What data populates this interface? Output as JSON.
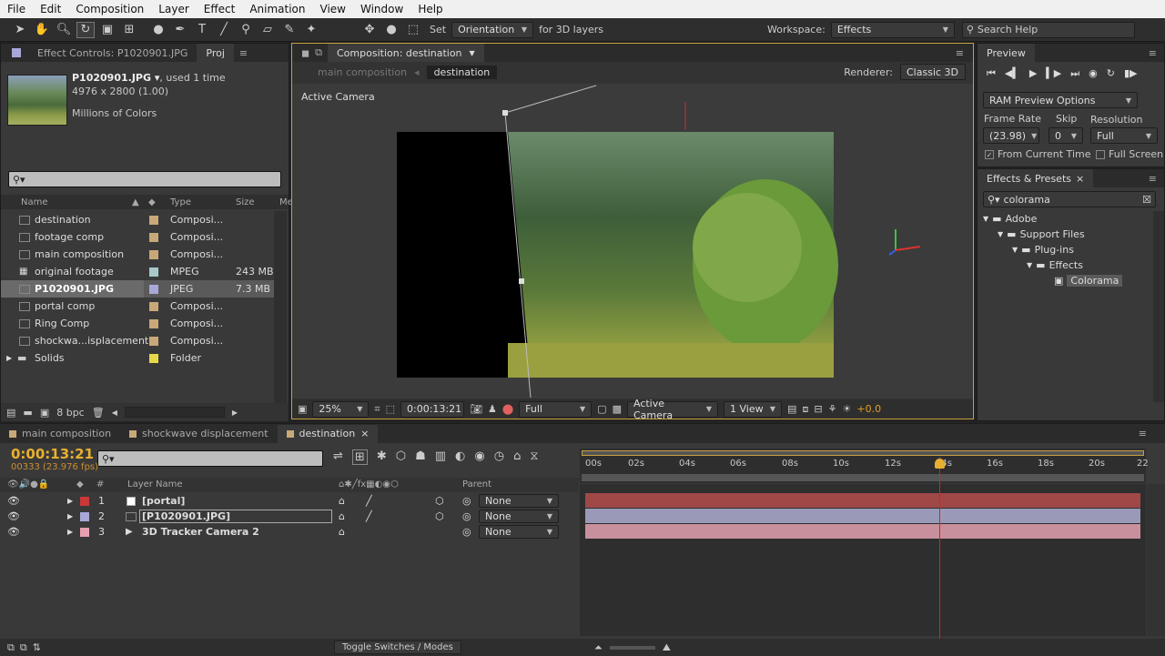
{
  "menu": [
    "File",
    "Edit",
    "Composition",
    "Layer",
    "Effect",
    "Animation",
    "View",
    "Window",
    "Help"
  ],
  "toolbar": {
    "set_label": "Set",
    "orientation": "Orientation",
    "for3d": "for 3D layers",
    "workspace_label": "Workspace:",
    "workspace_value": "Effects",
    "search_help": "Search Help"
  },
  "project": {
    "tab_effect": "Effect Controls: P1020901.JPG",
    "tab_proj": "Proj",
    "file_name": "P1020901.JPG ▾",
    "used": ", used 1 time",
    "dims": "4976 x 2800 (1.00)",
    "colors": "Millions of Colors",
    "col_name": "Name",
    "col_type": "Type",
    "col_size": "Size",
    "col_more": "Me",
    "items": [
      {
        "name": "destination",
        "type": "Composi...",
        "size": "",
        "color": "#c8a878",
        "icon": "comp"
      },
      {
        "name": "footage comp",
        "type": "Composi...",
        "size": "",
        "color": "#c8a878",
        "icon": "comp"
      },
      {
        "name": "main composition",
        "type": "Composi...",
        "size": "",
        "color": "#c8a878",
        "icon": "comp"
      },
      {
        "name": "original footage",
        "type": "MPEG",
        "size": "243 MB",
        "color": "#a8c8c8",
        "icon": "film"
      },
      {
        "name": "P1020901.JPG",
        "type": "JPEG",
        "size": "7.3 MB",
        "color": "#a8a8d8",
        "icon": "img"
      },
      {
        "name": "portal comp",
        "type": "Composi...",
        "size": "",
        "color": "#c8a878",
        "icon": "comp"
      },
      {
        "name": "Ring Comp",
        "type": "Composi...",
        "size": "",
        "color": "#c8a878",
        "icon": "comp"
      },
      {
        "name": "shockwa...isplacement",
        "type": "Composi...",
        "size": "",
        "color": "#c8a878",
        "icon": "comp"
      },
      {
        "name": "Solids",
        "type": "Folder",
        "size": "",
        "color": "#e8d848",
        "icon": "folder"
      }
    ],
    "bpc": "8 bpc"
  },
  "comp": {
    "tab": "Composition: destination",
    "crumb_main": "main composition",
    "crumb_dest": "destination",
    "renderer_label": "Renderer:",
    "renderer": "Classic 3D",
    "active_camera": "Active Camera",
    "zoom": "25%",
    "timecode": "0:00:13:21",
    "res": "Full",
    "view_cam": "Active Camera",
    "views": "1 View",
    "offset": "+0.0"
  },
  "preview": {
    "title": "Preview",
    "ram": "RAM Preview Options",
    "fr_label": "Frame Rate",
    "skip_label": "Skip",
    "res_label": "Resolution",
    "fr": "(23.98)",
    "skip": "0",
    "res": "Full",
    "from_current": "From Current Time",
    "full_screen": "Full Screen"
  },
  "effects": {
    "title": "Effects & Presets",
    "search": "colorama",
    "tree": [
      {
        "label": "Adobe",
        "depth": 0
      },
      {
        "label": "Support Files",
        "depth": 1
      },
      {
        "label": "Plug-ins",
        "depth": 2
      },
      {
        "label": "Effects",
        "depth": 3
      },
      {
        "label": "Colorama",
        "depth": 4
      }
    ]
  },
  "timeline": {
    "tabs": [
      "main composition",
      "shockwave displacement",
      "destination"
    ],
    "time": "0:00:13:21",
    "frames": "00333 (23.976 fps)",
    "col_layer": "Layer Name",
    "col_parent": "Parent",
    "col_hash": "#",
    "ruler": [
      "00s",
      "02s",
      "04s",
      "06s",
      "08s",
      "10s",
      "12s",
      "14s",
      "16s",
      "18s",
      "20s",
      "22"
    ],
    "layers": [
      {
        "num": "1",
        "name": "[portal]",
        "label_color": "#c83838",
        "bar_color": "#a04848",
        "parent": "None"
      },
      {
        "num": "2",
        "name": "[P1020901.JPG]",
        "label_color": "#a8a8d8",
        "bar_color": "#9a9ab8",
        "parent": "None"
      },
      {
        "num": "3",
        "name": "3D Tracker Camera 2",
        "label_color": "#e8a0b0",
        "bar_color": "#c8909c",
        "parent": "None"
      }
    ],
    "toggle": "Toggle Switches / Modes"
  }
}
